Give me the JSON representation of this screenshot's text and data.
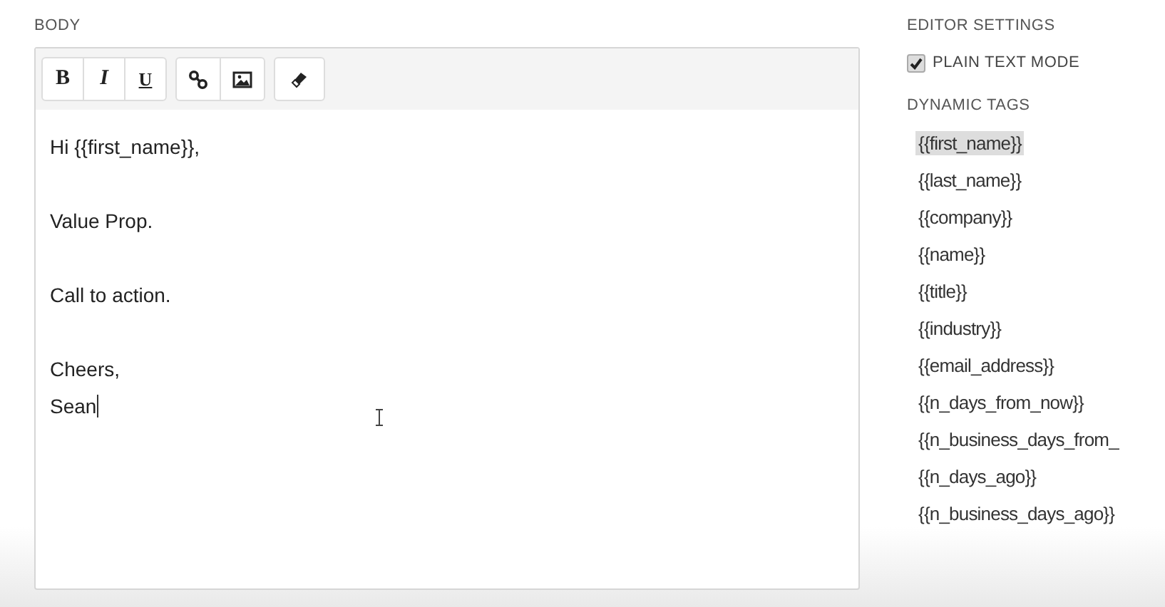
{
  "body_label": "BODY",
  "toolbar": [
    {
      "kind": "bold",
      "label": "B"
    },
    {
      "kind": "italic",
      "label": "I"
    },
    {
      "kind": "underline",
      "label": "U"
    },
    {
      "kind": "link"
    },
    {
      "kind": "image"
    },
    {
      "kind": "eraser"
    }
  ],
  "paragraphs": [
    [
      "Hi {{first_name}},"
    ],
    [
      "Value Prop."
    ],
    [
      "Call to action."
    ],
    [
      "Cheers,",
      "Sean"
    ]
  ],
  "editor_settings": {
    "heading": "EDITOR SETTINGS",
    "plain_text_mode": {
      "label": "PLAIN TEXT MODE",
      "checked": true
    }
  },
  "dynamic_tags": {
    "heading": "DYNAMIC TAGS",
    "items": [
      {
        "label": "{{first_name}}",
        "selected": true
      },
      {
        "label": "{{last_name}}",
        "selected": false
      },
      {
        "label": "{{company}}",
        "selected": false
      },
      {
        "label": "{{name}}",
        "selected": false
      },
      {
        "label": "{{title}}",
        "selected": false
      },
      {
        "label": "{{industry}}",
        "selected": false
      },
      {
        "label": "{{email_address}}",
        "selected": false
      },
      {
        "label": "{{n_days_from_now}}",
        "selected": false
      },
      {
        "label": "{{n_business_days_from_",
        "selected": false
      },
      {
        "label": "{{n_days_ago}}",
        "selected": false
      },
      {
        "label": "{{n_business_days_ago}}",
        "selected": false
      }
    ]
  }
}
